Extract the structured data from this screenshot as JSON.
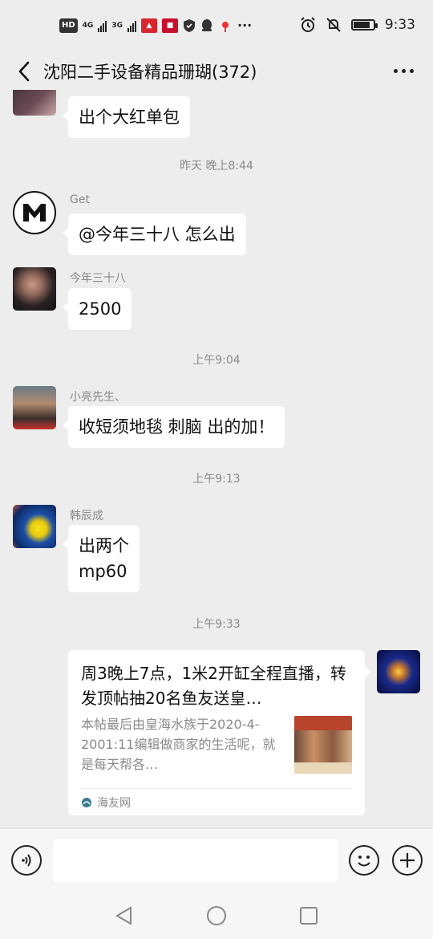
{
  "status_bar": {
    "hd_label": "HD",
    "net1": "4G",
    "net2": "3G",
    "time": "9:33",
    "battery_level": 0.85
  },
  "header": {
    "title": "沈阳二手设备精品珊瑚(372)"
  },
  "messages": {
    "m1": {
      "text": "出个大红单包"
    },
    "t1": "昨天 晚上8:44",
    "m2": {
      "sender": "Get",
      "text": "@今年三十八  怎么出"
    },
    "m3": {
      "sender": "今年三十八",
      "text": "2500"
    },
    "t2": "上午9:04",
    "m4": {
      "sender": "小亮先生、",
      "text": "收短须地毯 刺脑 出的加！"
    },
    "t3": "上午9:13",
    "m5": {
      "sender": "韩辰成",
      "line1": "出两个",
      "line2": "mp60"
    },
    "t4": "上午9:33",
    "m6": {
      "title": "周3晚上7点，1米2开缸全程直播，转发顶帖抽20名鱼友送皇…",
      "desc": "本帖最后由皇海水族于2020-4-2001:11编辑做商家的生活呢，就是每天帮各…",
      "source": "海友网"
    }
  },
  "input": {
    "placeholder": ""
  },
  "icons": {
    "back": "back-arrow-icon",
    "more": "more-dots-icon",
    "voice": "voice-icon",
    "emoji": "emoji-icon",
    "plus": "plus-icon"
  }
}
